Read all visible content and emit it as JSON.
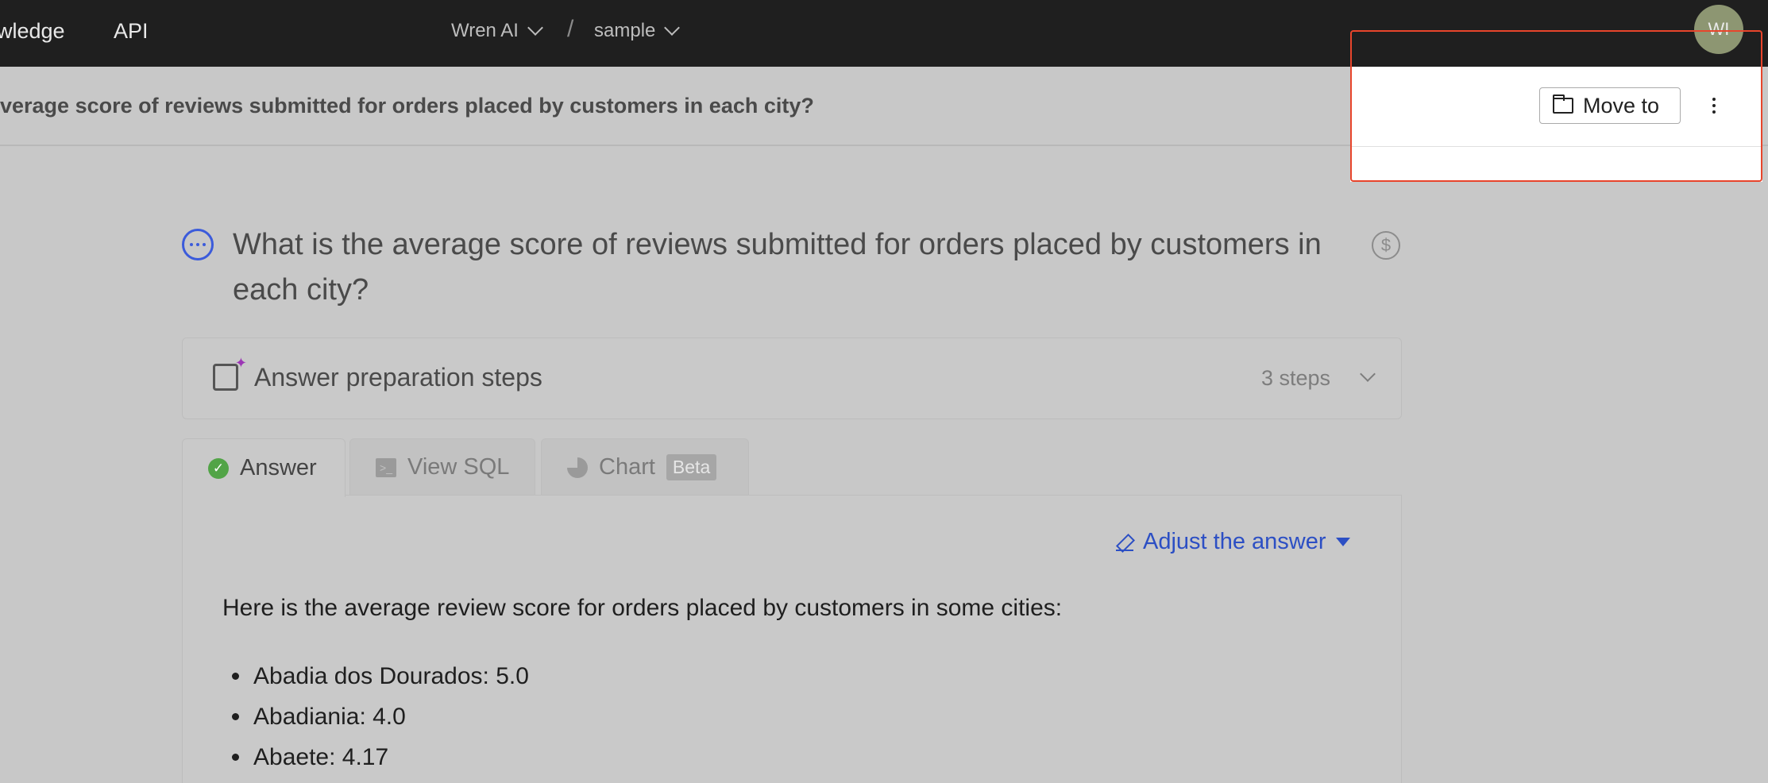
{
  "nav": {
    "items": [
      {
        "label": "wledge"
      },
      {
        "label": "API"
      }
    ],
    "project": "Wren AI",
    "dataset": "sample",
    "separator": "/",
    "avatar": "WI"
  },
  "thread": {
    "title": "verage score of reviews submitted for orders placed by customers in each city?",
    "move_label": "Move to"
  },
  "question": {
    "text": "What is the average score of reviews submitted for orders placed by customers in each city?"
  },
  "preparation": {
    "title": "Answer preparation steps",
    "steps": "3 steps"
  },
  "tabs": {
    "answer": "Answer",
    "sql": "View SQL",
    "chart": "Chart",
    "chart_badge": "Beta"
  },
  "answer": {
    "adjust_label": "Adjust the answer",
    "intro": "Here is the average review score for orders placed by customers in some cities:",
    "items": [
      "Abadia dos Dourados: 5.0",
      "Abadiania: 4.0",
      "Abaete: 4.17"
    ]
  },
  "colors": {
    "accent": "#2c4fc4",
    "highlight": "#e8452c",
    "success": "#52a447"
  }
}
